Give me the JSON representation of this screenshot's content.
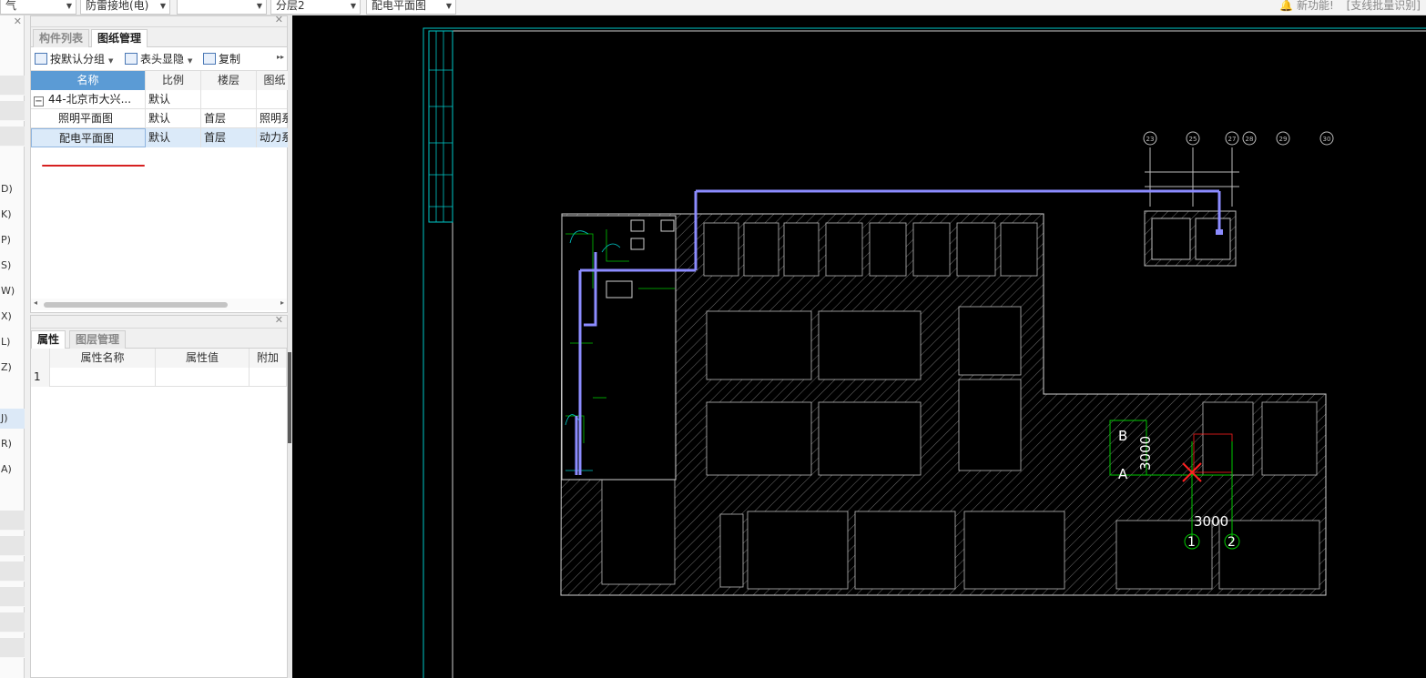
{
  "toolbar": {
    "combo1": "气",
    "combo2": "防雷接地(电)",
    "combo3": "",
    "combo4": "分层2",
    "combo5": "配电平面图",
    "new_feature": "新功能!",
    "batch_recognize": "[支线批量识别]"
  },
  "left_strip": {
    "items": [
      "D)",
      "K)",
      "P)",
      "S)",
      "W)",
      "X)",
      "L)",
      "Z)",
      "J)",
      "R)",
      "A)"
    ]
  },
  "drawing_panel": {
    "tabs": [
      "构件列表",
      "图纸管理"
    ],
    "active_tab": "图纸管理",
    "actions": {
      "group": "按默认分组",
      "header_toggle": "表头显隐",
      "copy": "复制"
    },
    "columns": [
      "名称",
      "比例",
      "楼层",
      "图纸"
    ],
    "rows": [
      {
        "name": "44-北京市大兴...",
        "scale": "默认",
        "floor": "",
        "type": ""
      },
      {
        "name": "照明平面图",
        "scale": "默认",
        "floor": "首层",
        "type": "照明系"
      },
      {
        "name": "配电平面图",
        "scale": "默认",
        "floor": "首层",
        "type": "动力系"
      }
    ]
  },
  "property_panel": {
    "tabs": [
      "属性",
      "图层管理"
    ],
    "active_tab": "属性",
    "columns": [
      "属性名称",
      "属性值",
      "附加"
    ],
    "rows": [
      {
        "index": "1",
        "name": "",
        "value": "",
        "extra": ""
      }
    ]
  },
  "cad": {
    "axis_labels_top": [
      "23",
      "25",
      "27",
      "28",
      "29",
      "30"
    ],
    "grid_letters": [
      "B",
      "A"
    ],
    "grid_numbers": [
      "1",
      "2"
    ],
    "dim_vertical": "3000",
    "dim_horizontal": "3000"
  },
  "colors": {
    "accent": "#5b9bd5",
    "canvas_bg": "#000000",
    "frame": "#00c8c8",
    "pipe": "#8c8cff",
    "green": "#00c800",
    "marker_red": "#ff2020"
  }
}
